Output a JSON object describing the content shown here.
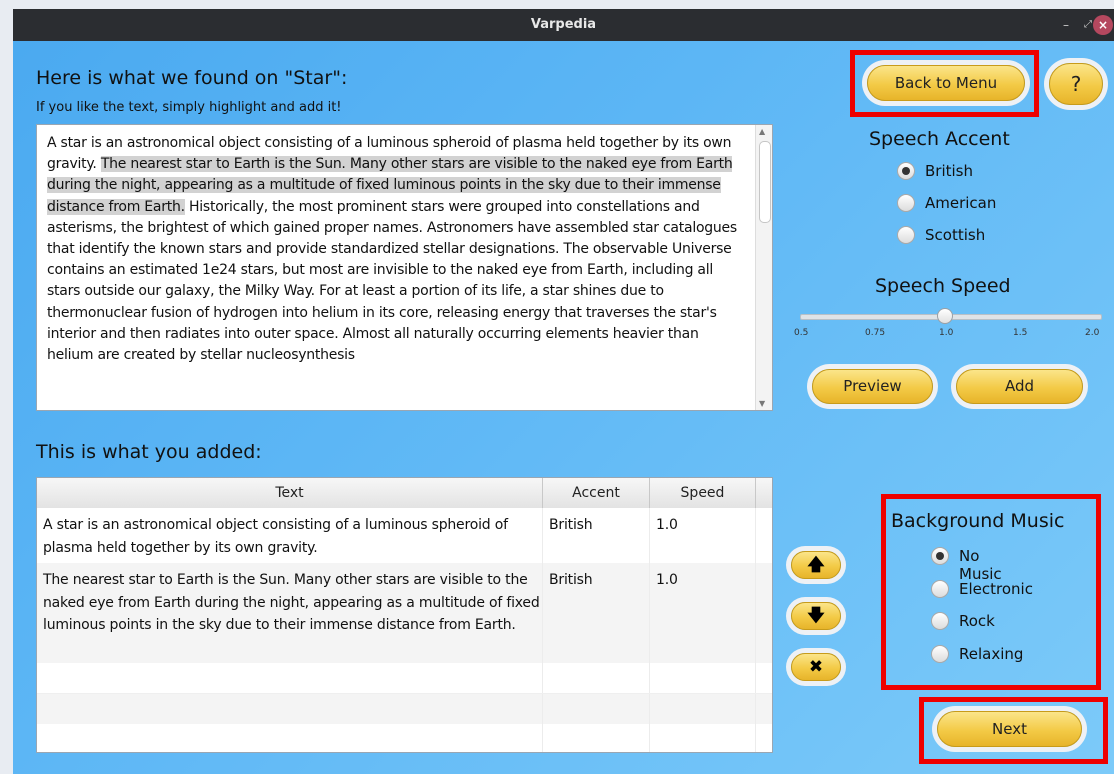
{
  "window": {
    "title": "Varpedia",
    "minimize_glyph": "–",
    "maximize_glyph": "⤢",
    "close_glyph": "×"
  },
  "search": {
    "heading": "Here is what we found on \"Star\":",
    "subheading": "If you like the text, simply highlight and add it!",
    "text_before_highlight": "A star is an astronomical object consisting of a luminous spheroid of plasma held together by its own gravity.",
    "text_highlighted": "The nearest star to Earth is the Sun. Many other stars are visible to the naked eye from Earth during the night, appearing as a multitude of fixed luminous points in the sky due to their immense distance from Earth.",
    "text_after_highlight": "Historically, the most prominent stars were grouped into constellations and asterisms, the brightest of which gained proper names. Astronomers have assembled star catalogues that identify the known stars and provide standardized stellar designations. The observable Universe contains an estimated 1e24 stars, but most are invisible to the naked eye from Earth, including all stars outside our galaxy, the Milky Way. For at least a portion of its life, a star shines due to thermonuclear fusion of hydrogen into helium in its core, releasing energy that traverses the star's interior and then radiates into outer space. Almost all naturally occurring elements heavier than helium are created by stellar nucleosynthesis"
  },
  "buttons": {
    "back_to_menu": "Back to Menu",
    "help": "?",
    "preview": "Preview",
    "add": "Add",
    "next": "Next",
    "move_up_glyph": "🡅",
    "move_down_glyph": "🡇",
    "delete_glyph": "✖"
  },
  "speech_accent": {
    "title": "Speech Accent",
    "options": [
      "British",
      "American",
      "Scottish"
    ],
    "selected": "British"
  },
  "speech_speed": {
    "title": "Speech Speed",
    "ticks": [
      "0.5",
      "0.75",
      "1.0",
      "1.5",
      "2.0"
    ],
    "value": 1.0
  },
  "added": {
    "label": "This is what you added:",
    "columns": [
      "Text",
      "Accent",
      "Speed"
    ],
    "rows": [
      {
        "text": "A star is an astronomical object consisting of a luminous spheroid of plasma held together by its own gravity.",
        "accent": "British",
        "speed": "1.0"
      },
      {
        "text": "The nearest star to Earth is the Sun. Many other stars are visible to the naked eye from Earth during the night, appearing as a multitude of fixed luminous points in the sky due to their immense distance from Earth.",
        "accent": "British",
        "speed": "1.0"
      }
    ]
  },
  "background_music": {
    "title": "Background Music",
    "options": [
      "No Music",
      "Electronic",
      "Rock",
      "Relaxing"
    ],
    "selected": "No Music"
  },
  "colors": {
    "accent_button": "#f3ca46",
    "highlight_box": "#ee0000",
    "selection": "#d2d2d2"
  }
}
